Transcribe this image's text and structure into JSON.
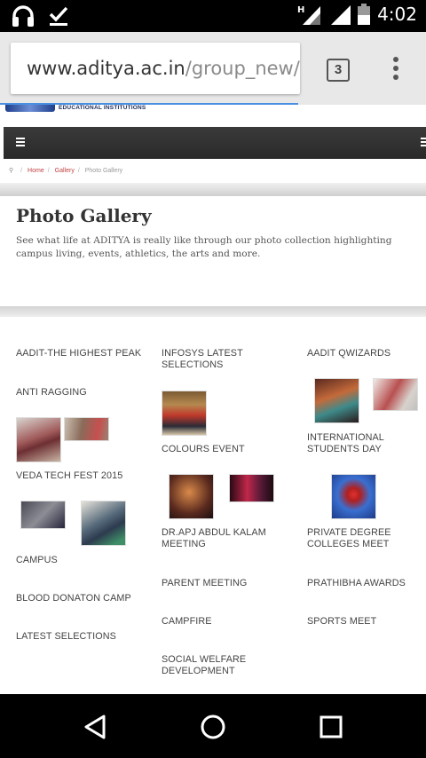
{
  "status_bar": {
    "time": "4:02",
    "icons": [
      "headphones-icon",
      "download-done-icon",
      "signal-h-icon",
      "signal-icon",
      "battery-icon"
    ]
  },
  "browser": {
    "url_host": "www.aditya.ac.in",
    "url_path": "/group_new/inde",
    "tab_count": "3",
    "load_progress_percent": 70
  },
  "site": {
    "logo_text": "EDUCATIONAL INSTITUTIONS",
    "breadcrumb": {
      "home": "Home",
      "gallery": "Gallery",
      "current": "Photo Gallery"
    },
    "title": "Photo Gallery",
    "description": "See what life at ADITYA is really like through our photo collection highlighting campus living, events, athletics, the arts and more."
  },
  "gallery": {
    "col1": [
      "AADIT-THE HIGHEST PEAK",
      "ANTI RAGGING",
      "VEDA TECH FEST 2015",
      "CAMPUS",
      "BLOOD DONATON CAMP",
      "LATEST SELECTIONS"
    ],
    "col2": [
      "INFOSYS LATEST SELECTIONS",
      "COLOURS EVENT",
      "DR.APJ ABDUL KALAM MEETING",
      "PARENT MEETING",
      "CAMPFIRE",
      "SOCIAL WELFARE DEVELOPMENT"
    ],
    "col3": [
      "AADIT QWIZARDS",
      "INTERNATIONAL STUDENTS DAY",
      "PRIVATE DEGREE COLLEGES MEET",
      "PRATHIBHA AWARDS",
      "SPORTS MEET"
    ]
  },
  "colors": {
    "accent_link": "#c24141",
    "navbar": "#2f2f2f",
    "progress": "#4a90e2"
  }
}
